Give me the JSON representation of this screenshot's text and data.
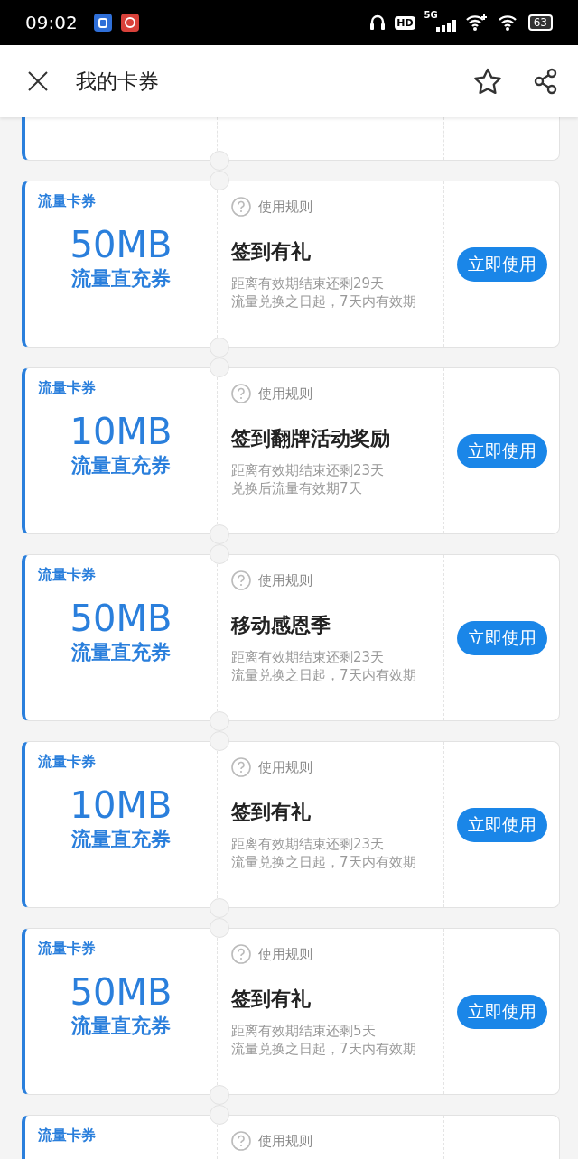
{
  "status_bar": {
    "time": "09:02",
    "hd": "HD",
    "network": "5G",
    "battery": "63"
  },
  "header": {
    "title": "我的卡券"
  },
  "coupons": [
    {
      "kind": "partial"
    },
    {
      "kind": "full",
      "tag": "流量卡券",
      "amount": "50MB",
      "type": "流量直充券",
      "rules": "使用规则",
      "title": "签到有礼",
      "lines": [
        "距离有效期结束还剩29天",
        "流量兑换之日起，7天内有效期"
      ],
      "button": "立即使用"
    },
    {
      "kind": "full",
      "tag": "流量卡券",
      "amount": "10MB",
      "type": "流量直充券",
      "rules": "使用规则",
      "title": "签到翻牌活动奖励",
      "lines": [
        "距离有效期结束还剩23天",
        "兑换后流量有效期7天"
      ],
      "button": "立即使用"
    },
    {
      "kind": "full",
      "tag": "流量卡券",
      "amount": "50MB",
      "type": "流量直充券",
      "rules": "使用规则",
      "title": "移动感恩季",
      "lines": [
        "距离有效期结束还剩23天",
        "流量兑换之日起，7天内有效期"
      ],
      "button": "立即使用"
    },
    {
      "kind": "full",
      "tag": "流量卡券",
      "amount": "10MB",
      "type": "流量直充券",
      "rules": "使用规则",
      "title": "签到有礼",
      "lines": [
        "距离有效期结束还剩23天",
        "流量兑换之日起，7天内有效期"
      ],
      "button": "立即使用"
    },
    {
      "kind": "full",
      "tag": "流量卡券",
      "amount": "50MB",
      "type": "流量直充券",
      "rules": "使用规则",
      "title": "签到有礼",
      "lines": [
        "距离有效期结束还剩5天",
        "流量兑换之日起，7天内有效期"
      ],
      "button": "立即使用"
    },
    {
      "kind": "full",
      "tag": "流量卡券",
      "rules": "使用规则"
    }
  ]
}
